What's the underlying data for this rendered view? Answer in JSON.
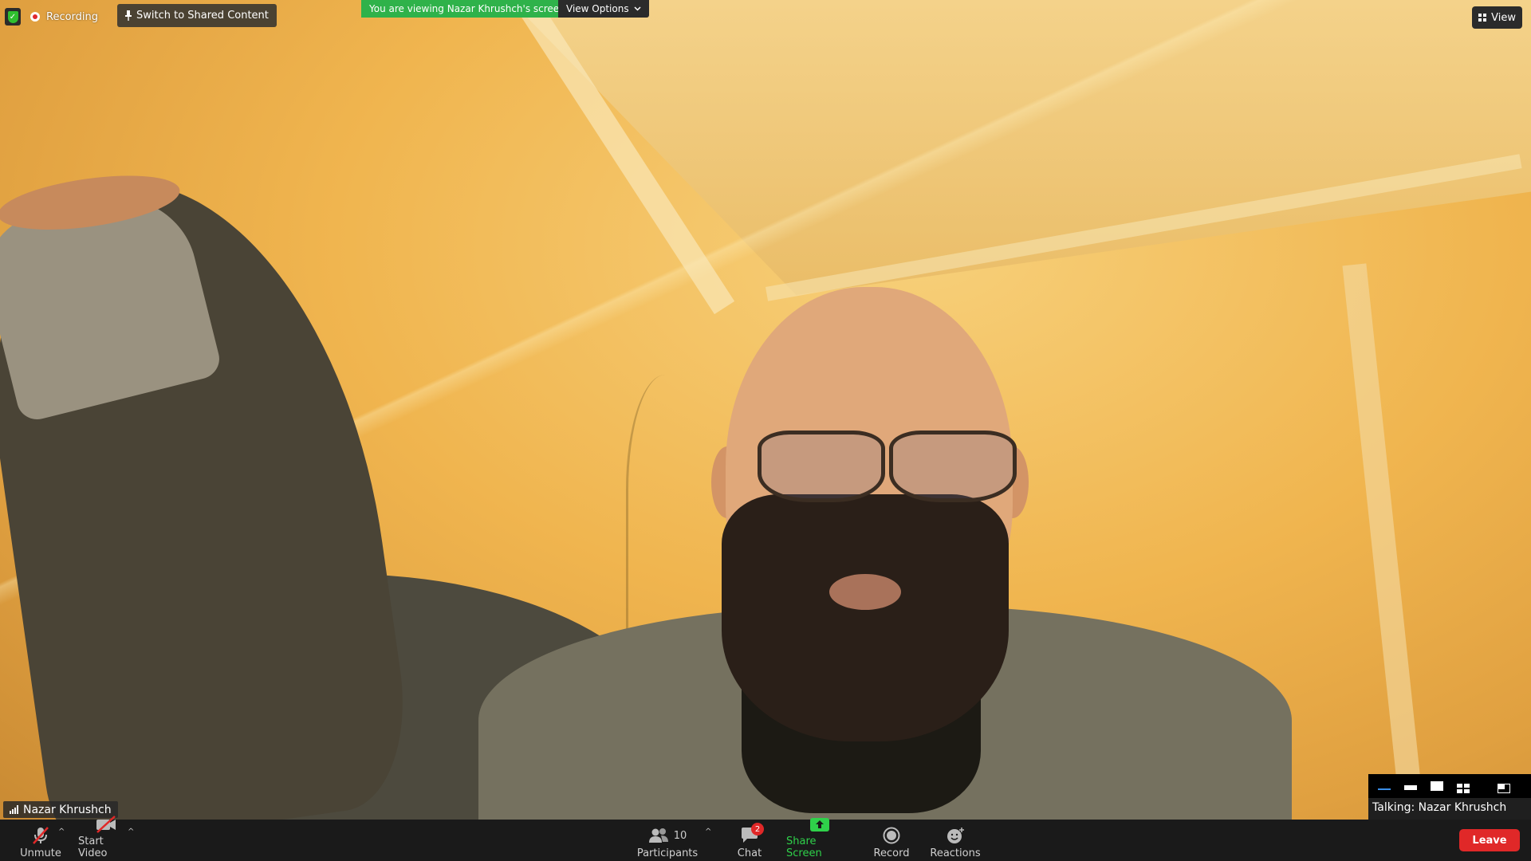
{
  "top": {
    "recording_label": "Recording",
    "switch_label": "Switch to Shared Content",
    "viewing_banner": "You are viewing Nazar Khrushch's screen",
    "view_options_label": "View Options",
    "view_label": "View"
  },
  "video": {
    "participant_name": "Nazar Khrushch"
  },
  "mini_panel": {
    "talking_label": "Talking: Nazar Khrushch"
  },
  "toolbar": {
    "unmute_label": "Unmute",
    "start_video_label": "Start Video",
    "participants_label": "Participants",
    "participants_count": "10",
    "chat_label": "Chat",
    "chat_badge": "2",
    "share_screen_label": "Share Screen",
    "record_label": "Record",
    "reactions_label": "Reactions",
    "leave_label": "Leave"
  },
  "colors": {
    "share_green": "#2fd14a",
    "leave_red": "#e02828",
    "banner_green": "#2fb24a"
  }
}
